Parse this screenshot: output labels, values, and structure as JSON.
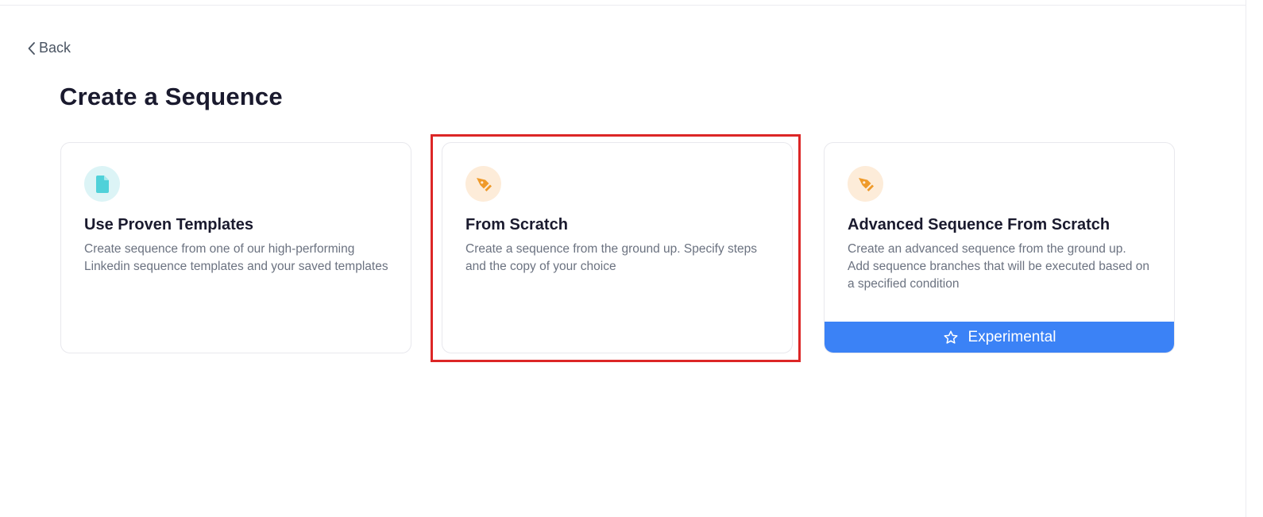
{
  "back": {
    "label": "Back"
  },
  "page": {
    "title": "Create a Sequence"
  },
  "cards": [
    {
      "icon": "document-icon",
      "title": "Use Proven Templates",
      "description_lines": [
        "Create sequence from one of our high-performing Linkedin sequence templates and your saved templates"
      ]
    },
    {
      "icon": "pen-tool-icon",
      "title": "From Scratch",
      "description_lines": [
        "Create a sequence from the ground up. Specify steps and the copy of your choice"
      ],
      "selected": true
    },
    {
      "icon": "pen-tool-icon",
      "title": "Advanced Sequence From Scratch",
      "description_lines": [
        "Create an advanced sequence from the ground up.",
        "Add sequence branches that will be executed based on a specified condition"
      ],
      "badge": {
        "icon": "star-icon",
        "label": "Experimental"
      }
    }
  ],
  "colors": {
    "teal_icon": "#4fd1d9",
    "teal_bg": "#dcf4f6",
    "orange_icon": "#ef9a2a",
    "orange_bg": "#fdecd9",
    "experimental_bg": "#3b82f6",
    "selection_outline": "#dc2626"
  }
}
